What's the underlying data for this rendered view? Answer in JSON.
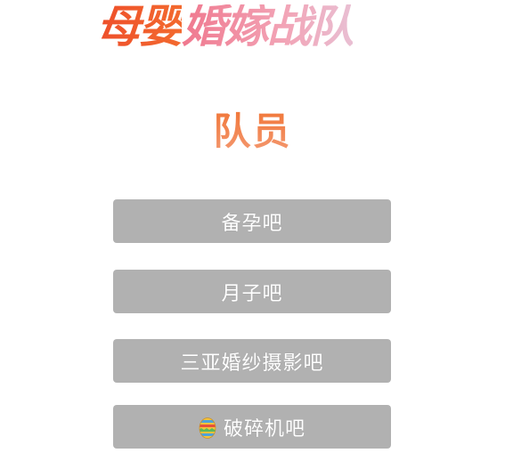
{
  "banner": {
    "title_part1": "母婴",
    "title_part2": "婚嫁战队"
  },
  "section": {
    "title": "队员"
  },
  "members": [
    {
      "label": "备孕吧",
      "icon": ""
    },
    {
      "label": "月子吧",
      "icon": ""
    },
    {
      "label": "三亚婚纱摄影吧",
      "icon": ""
    },
    {
      "label": "破碎机吧",
      "icon": "easter-egg-icon"
    }
  ],
  "colors": {
    "button_bg": "#b1b1b1",
    "button_text": "#ffffff",
    "title_orange": "#f0702e",
    "banner_red": "#ee4e2a",
    "banner_pink": "#f2a4b6"
  }
}
